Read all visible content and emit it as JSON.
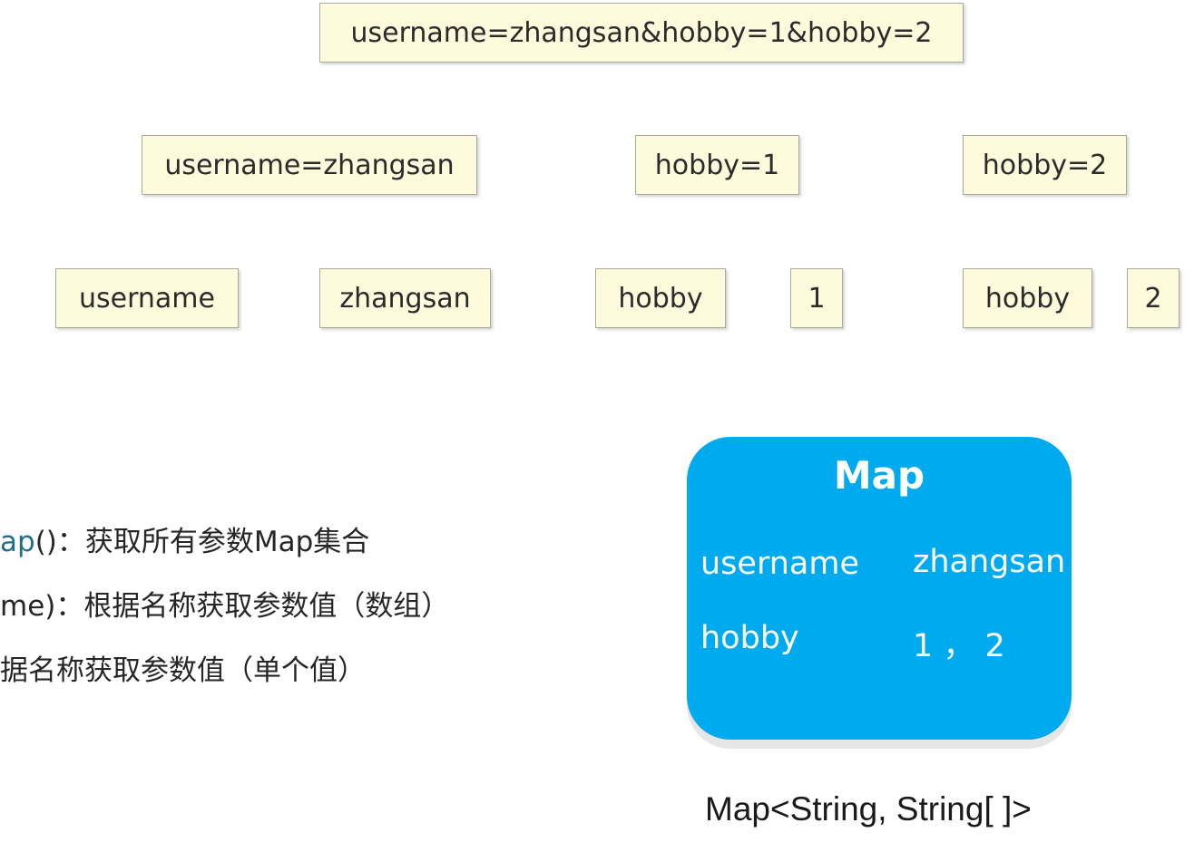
{
  "query_string": "username=zhangsan&hobby=1&hobby=2",
  "pairs": [
    "username=zhangsan",
    "hobby=1",
    "hobby=2"
  ],
  "tokens": [
    "username",
    "zhangsan",
    "hobby",
    "1",
    "hobby",
    "2"
  ],
  "methods": [
    {
      "name": "ap",
      "rest": "()：获取所有参数Map集合"
    },
    {
      "name": "",
      "rest": "me)：根据名称获取参数值（数组）"
    },
    {
      "name": "",
      "rest": "据名称获取参数值（单个值）"
    }
  ],
  "map": {
    "title": "Map",
    "rows": [
      {
        "key": "username",
        "value": "zhangsan"
      },
      {
        "key": "hobby",
        "value": "1 ， 2"
      }
    ],
    "type_label": "Map<String, String[ ]>"
  },
  "colors": {
    "box_fill": "#fdfbdc",
    "map_fill": "#00aaee",
    "method_accent": "#1f6f8b"
  }
}
